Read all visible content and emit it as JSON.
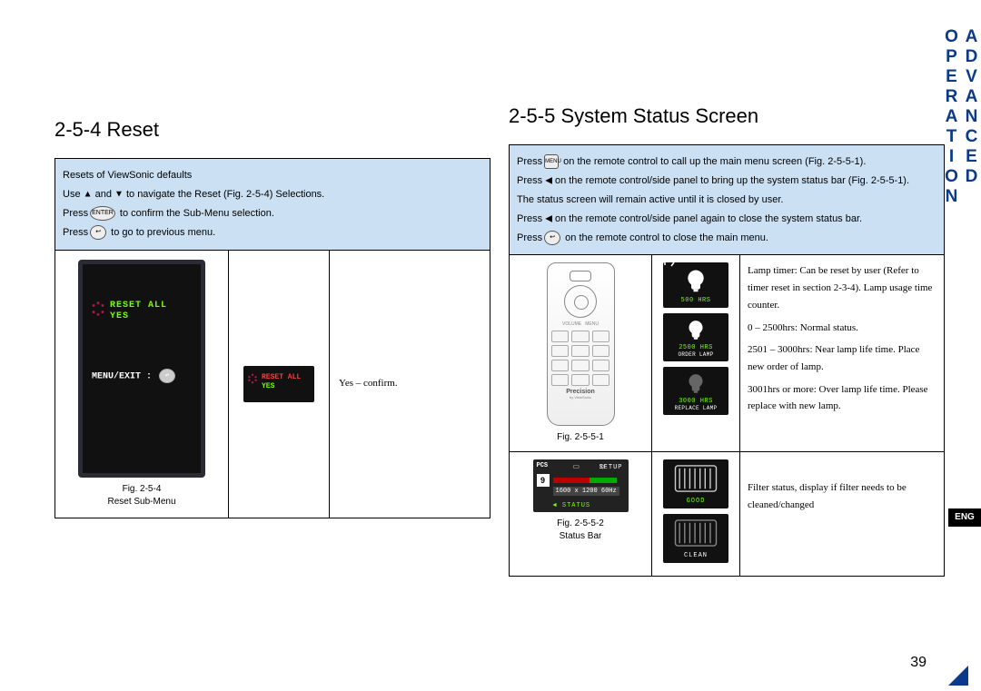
{
  "side_tab": "ADVANCED OPERATION",
  "eng_tab": "ENG",
  "page_number": "39",
  "left": {
    "heading": "2-5-4 Reset",
    "bluebox": {
      "l1": "Resets of ViewSonic defaults",
      "l2a": "Use ",
      "l2b": " and ",
      "l2c": " to navigate the Reset (Fig. 2-5-4) Selections.",
      "l3a": "Press",
      "l3b": " to confirm the Sub-Menu selection.",
      "l4a": "Press",
      "l4b": " to go to previous menu."
    },
    "fig254": {
      "reset_all": "RESET ALL",
      "yes": "YES",
      "menuexit": "MENU/EXIT :",
      "caption1": "Fig. 2-5-4",
      "caption2": "Reset Sub-Menu"
    },
    "small": {
      "reset_all": "RESET ALL",
      "yes": "YES",
      "desc": "Yes – confirm."
    }
  },
  "right": {
    "heading": "2-5-5 System Status Screen",
    "bluebox": {
      "l1a": "Press",
      "l1b": " on the remote control to call up the main menu screen (Fig. 2-5-5-1).",
      "l2a": "Press ",
      "l2b": " on the remote control/side panel to bring up the system status bar (Fig. 2-5-5-1).",
      "l3": "The status screen will remain active until it is closed by user.",
      "l4a": "Press ",
      "l4b": " on the remote control/side panel again to close the system status bar.",
      "l5a": "Press",
      "l5b": " on the remote control to close the main menu."
    },
    "remote": {
      "brand": "Precision",
      "sub": "by ViewSonic",
      "caption": "Fig. 2-5-5-1"
    },
    "lamp": {
      "c1": "500 HRS",
      "c2a": "2500 HRS",
      "c2b": "ORDER LAMP",
      "c3a": "3000 HRS",
      "c3b": "REPLACE LAMP",
      "desc1": "Lamp timer: Can be reset by user (Refer to timer reset in section 2-3-4). Lamp usage time counter.",
      "desc2": "0 – 2500hrs: Normal status.",
      "desc3": "2501 – 3000hrs: Near lamp life time. Place new order of lamp.",
      "desc4": "3001hrs or more: Over lamp life time. Please replace with new lamp."
    },
    "status": {
      "pcs": "PCS",
      "setup": "SETUP",
      "nine": "9",
      "res": "1600 x 1200 60Hz",
      "statustxt": "◄ STATUS",
      "caption1": "Fig. 2-5-5-2",
      "caption2": "Status Bar"
    },
    "filter": {
      "good": "GOOD",
      "clean": "CLEAN",
      "desc": "Filter status, display if filter needs to be cleaned/changed"
    }
  }
}
